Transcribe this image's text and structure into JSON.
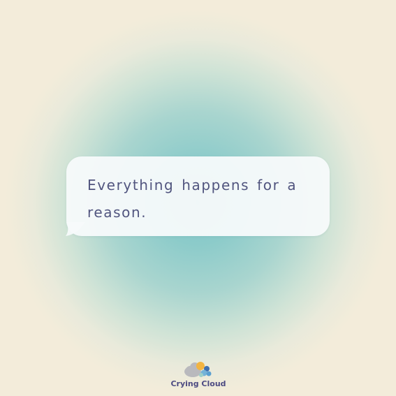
{
  "message": {
    "text": "Everything happens for a reason."
  },
  "brand": {
    "name": "Crying Cloud",
    "logo_icon": "crying-cloud-logo-icon"
  },
  "colors": {
    "background": "#f3ecda",
    "glow": "#7fc6c8",
    "bubble": "#f7fafb",
    "text": "#51557f",
    "brand_text": "#4d4b82"
  }
}
